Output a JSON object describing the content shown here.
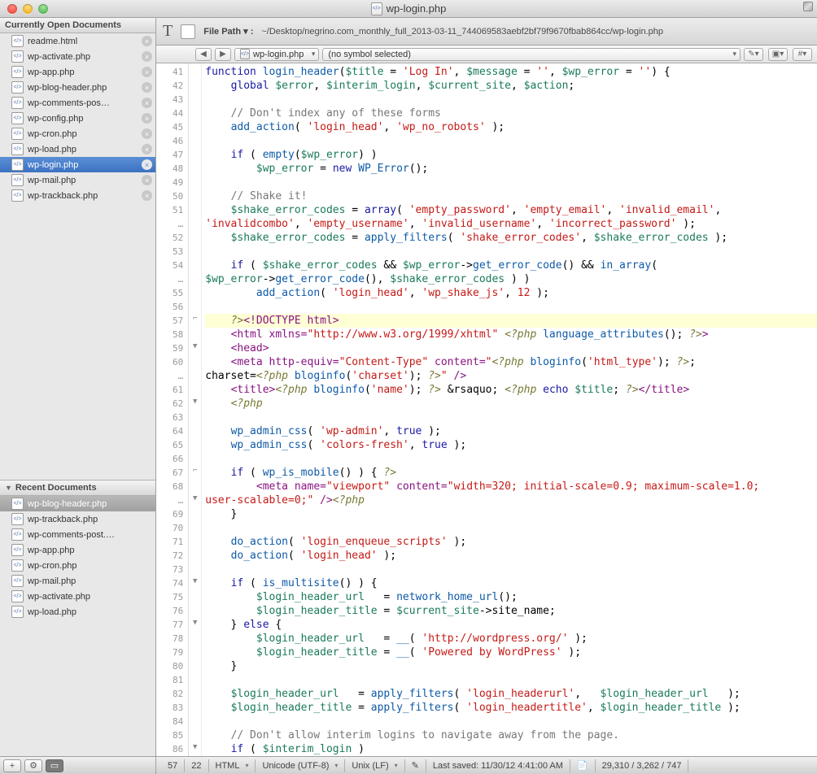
{
  "window": {
    "title": "wp-login.php"
  },
  "sidebar": {
    "open_header": "Currently Open Documents",
    "recent_header": "Recent Documents",
    "open_items": [
      {
        "name": "readme.html",
        "active": false,
        "icon": "htm"
      },
      {
        "name": "wp-activate.php",
        "active": false,
        "icon": "php"
      },
      {
        "name": "wp-app.php",
        "active": false,
        "icon": "php"
      },
      {
        "name": "wp-blog-header.php",
        "active": false,
        "icon": "php"
      },
      {
        "name": "wp-comments-pos…",
        "active": false,
        "icon": "php"
      },
      {
        "name": "wp-config.php",
        "active": false,
        "icon": "php"
      },
      {
        "name": "wp-cron.php",
        "active": false,
        "icon": "php"
      },
      {
        "name": "wp-load.php",
        "active": false,
        "icon": "php"
      },
      {
        "name": "wp-login.php",
        "active": true,
        "icon": "php"
      },
      {
        "name": "wp-mail.php",
        "active": false,
        "icon": "php"
      },
      {
        "name": "wp-trackback.php",
        "active": false,
        "icon": "php"
      }
    ],
    "recent_items": [
      {
        "name": "wp-blog-header.php",
        "active": true
      },
      {
        "name": "wp-trackback.php",
        "active": false
      },
      {
        "name": "wp-comments-post.…",
        "active": false
      },
      {
        "name": "wp-app.php",
        "active": false
      },
      {
        "name": "wp-cron.php",
        "active": false
      },
      {
        "name": "wp-mail.php",
        "active": false
      },
      {
        "name": "wp-activate.php",
        "active": false
      },
      {
        "name": "wp-load.php",
        "active": false
      }
    ]
  },
  "filepath": {
    "label": "File Path ▾ :",
    "value": "~/Desktop/negrino.com_monthly_full_2013-03-11_744069583aebf2bf79f9670fbab864cc/wp-login.php"
  },
  "nav": {
    "crumb1": "wp-login.php",
    "crumb2": "(no symbol selected)"
  },
  "status": {
    "line": "57",
    "col": "22",
    "lang": "HTML",
    "encoding": "Unicode (UTF-8)",
    "lineend": "Unix (LF)",
    "saved": "Last saved: 11/30/12 4:41:00 AM",
    "counts": "29,310 / 3,262 / 747"
  },
  "code_lines": [
    {
      "n": "41",
      "f": "",
      "html": "<span class='kw'>function</span> <span class='fn'>login_header</span>(<span class='var'>$title</span> = <span class='str'>'Log In'</span>, <span class='var'>$message</span> = <span class='str'>''</span>, <span class='var'>$wp_error</span> = <span class='str'>''</span>) {"
    },
    {
      "n": "42",
      "f": "",
      "html": "    <span class='kw'>global</span> <span class='var'>$error</span>, <span class='var'>$interim_login</span>, <span class='var'>$current_site</span>, <span class='var'>$action</span>;"
    },
    {
      "n": "43",
      "f": "",
      "html": ""
    },
    {
      "n": "44",
      "f": "",
      "html": "    <span class='cmt'>// Don't index any of these forms</span>"
    },
    {
      "n": "45",
      "f": "",
      "html": "    <span class='fn'>add_action</span>( <span class='str'>'login_head'</span>, <span class='str'>'wp_no_robots'</span> );"
    },
    {
      "n": "46",
      "f": "",
      "html": ""
    },
    {
      "n": "47",
      "f": "",
      "html": "    <span class='kw'>if</span> ( <span class='fn'>empty</span>(<span class='var'>$wp_error</span>) )"
    },
    {
      "n": "48",
      "f": "",
      "html": "        <span class='var'>$wp_error</span> = <span class='kw'>new</span> <span class='fn'>WP_Error</span>();"
    },
    {
      "n": "49",
      "f": "",
      "html": ""
    },
    {
      "n": "50",
      "f": "",
      "html": "    <span class='cmt'>// Shake it!</span>"
    },
    {
      "n": "51",
      "f": "",
      "html": "    <span class='var'>$shake_error_codes</span> = <span class='kw'>array</span>( <span class='str'>'empty_password'</span>, <span class='str'>'empty_email'</span>, <span class='str'>'invalid_email'</span>,"
    },
    {
      "n": "…",
      "f": "",
      "html": "<span class='str'>'invalidcombo'</span>, <span class='str'>'empty_username'</span>, <span class='str'>'invalid_username'</span>, <span class='str'>'incorrect_password'</span> );"
    },
    {
      "n": "52",
      "f": "",
      "html": "    <span class='var'>$shake_error_codes</span> = <span class='fn'>apply_filters</span>( <span class='str'>'shake_error_codes'</span>, <span class='var'>$shake_error_codes</span> );"
    },
    {
      "n": "53",
      "f": "",
      "html": ""
    },
    {
      "n": "54",
      "f": "",
      "html": "    <span class='kw'>if</span> ( <span class='var'>$shake_error_codes</span> &amp;&amp; <span class='var'>$wp_error</span>-&gt;<span class='fn'>get_error_code</span>() &amp;&amp; <span class='fn'>in_array</span>("
    },
    {
      "n": "…",
      "f": "",
      "html": "<span class='var'>$wp_error</span>-&gt;<span class='fn'>get_error_code</span>(), <span class='var'>$shake_error_codes</span> ) )"
    },
    {
      "n": "55",
      "f": "",
      "html": "        <span class='fn'>add_action</span>( <span class='str'>'login_head'</span>, <span class='str'>'wp_shake_js'</span>, <span class='num'>12</span> );"
    },
    {
      "n": "56",
      "f": "",
      "html": ""
    },
    {
      "n": "57",
      "f": "⌐",
      "hl": true,
      "html": "    <span class='php'>?&gt;</span><span class='tag'>&lt;!DOCTYPE html&gt;</span>"
    },
    {
      "n": "58",
      "f": "",
      "html": "    <span class='tag'>&lt;html</span> <span class='attr'>xmlns=</span><span class='str'>\"http://www.w3.org/1999/xhtml\"</span> <span class='php'>&lt;?php</span> <span class='fn'>language_attributes</span>(); <span class='php'>?&gt;</span><span class='tag'>&gt;</span>"
    },
    {
      "n": "59",
      "f": "▼",
      "html": "    <span class='tag'>&lt;head&gt;</span>"
    },
    {
      "n": "60",
      "f": "",
      "html": "    <span class='tag'>&lt;meta</span> <span class='attr'>http-equiv=</span><span class='str'>\"Content-Type\"</span> <span class='attr'>content=</span><span class='str'>\"</span><span class='php'>&lt;?php</span> <span class='fn'>bloginfo</span>(<span class='str'>'html_type'</span>); <span class='php'>?&gt;</span>;"
    },
    {
      "n": "…",
      "f": "",
      "html": "charset=<span class='php'>&lt;?php</span> <span class='fn'>bloginfo</span>(<span class='str'>'charset'</span>); <span class='php'>?&gt;</span><span class='str'>\"</span> <span class='tag'>/&gt;</span>"
    },
    {
      "n": "61",
      "f": "",
      "html": "    <span class='tag'>&lt;title&gt;</span><span class='php'>&lt;?php</span> <span class='fn'>bloginfo</span>(<span class='str'>'name'</span>); <span class='php'>?&gt;</span> &amp;rsaquo; <span class='php'>&lt;?php</span> <span class='kw'>echo</span> <span class='var'>$title</span>; <span class='php'>?&gt;</span><span class='tag'>&lt;/title&gt;</span>"
    },
    {
      "n": "62",
      "f": "▼",
      "html": "    <span class='php'>&lt;?php</span>"
    },
    {
      "n": "63",
      "f": "",
      "html": ""
    },
    {
      "n": "64",
      "f": "",
      "html": "    <span class='fn'>wp_admin_css</span>( <span class='str'>'wp-admin'</span>, <span class='kw'>true</span> );"
    },
    {
      "n": "65",
      "f": "",
      "html": "    <span class='fn'>wp_admin_css</span>( <span class='str'>'colors-fresh'</span>, <span class='kw'>true</span> );"
    },
    {
      "n": "66",
      "f": "",
      "html": ""
    },
    {
      "n": "67",
      "f": "⌐",
      "html": "    <span class='kw'>if</span> ( <span class='fn'>wp_is_mobile</span>() ) { <span class='php'>?&gt;</span>"
    },
    {
      "n": "68",
      "f": "",
      "html": "        <span class='tag'>&lt;meta</span> <span class='attr'>name=</span><span class='str'>\"viewport\"</span> <span class='attr'>content=</span><span class='str'>\"width=320; initial-scale=0.9; maximum-scale=1.0;</span>"
    },
    {
      "n": "…",
      "f": "▼",
      "html": "<span class='str'>user-scalable=0;\"</span> <span class='tag'>/&gt;</span><span class='php'>&lt;?php</span>"
    },
    {
      "n": "69",
      "f": "",
      "html": "    }"
    },
    {
      "n": "70",
      "f": "",
      "html": ""
    },
    {
      "n": "71",
      "f": "",
      "html": "    <span class='fn'>do_action</span>( <span class='str'>'login_enqueue_scripts'</span> );"
    },
    {
      "n": "72",
      "f": "",
      "html": "    <span class='fn'>do_action</span>( <span class='str'>'login_head'</span> );"
    },
    {
      "n": "73",
      "f": "",
      "html": ""
    },
    {
      "n": "74",
      "f": "▼",
      "html": "    <span class='kw'>if</span> ( <span class='fn'>is_multisite</span>() ) {"
    },
    {
      "n": "75",
      "f": "",
      "html": "        <span class='var'>$login_header_url</span>   = <span class='fn'>network_home_url</span>();"
    },
    {
      "n": "76",
      "f": "",
      "html": "        <span class='var'>$login_header_title</span> = <span class='var'>$current_site</span>-&gt;site_name;"
    },
    {
      "n": "77",
      "f": "▼",
      "html": "    } <span class='kw'>else</span> {"
    },
    {
      "n": "78",
      "f": "",
      "html": "        <span class='var'>$login_header_url</span>   = <span class='fn'>__</span>( <span class='str'>'http://wordpress.org/'</span> );"
    },
    {
      "n": "79",
      "f": "",
      "html": "        <span class='var'>$login_header_title</span> = <span class='fn'>__</span>( <span class='str'>'Powered by WordPress'</span> );"
    },
    {
      "n": "80",
      "f": "",
      "html": "    }"
    },
    {
      "n": "81",
      "f": "",
      "html": ""
    },
    {
      "n": "82",
      "f": "",
      "html": "    <span class='var'>$login_header_url</span>   = <span class='fn'>apply_filters</span>( <span class='str'>'login_headerurl'</span>,   <span class='var'>$login_header_url</span>   );"
    },
    {
      "n": "83",
      "f": "",
      "html": "    <span class='var'>$login_header_title</span> = <span class='fn'>apply_filters</span>( <span class='str'>'login_headertitle'</span>, <span class='var'>$login_header_title</span> );"
    },
    {
      "n": "84",
      "f": "",
      "html": ""
    },
    {
      "n": "85",
      "f": "",
      "html": "    <span class='cmt'>// Don't allow interim logins to navigate away from the page.</span>"
    },
    {
      "n": "86",
      "f": "▼",
      "html": "    <span class='kw'>if</span> ( <span class='var'>$interim_login</span> )"
    }
  ]
}
